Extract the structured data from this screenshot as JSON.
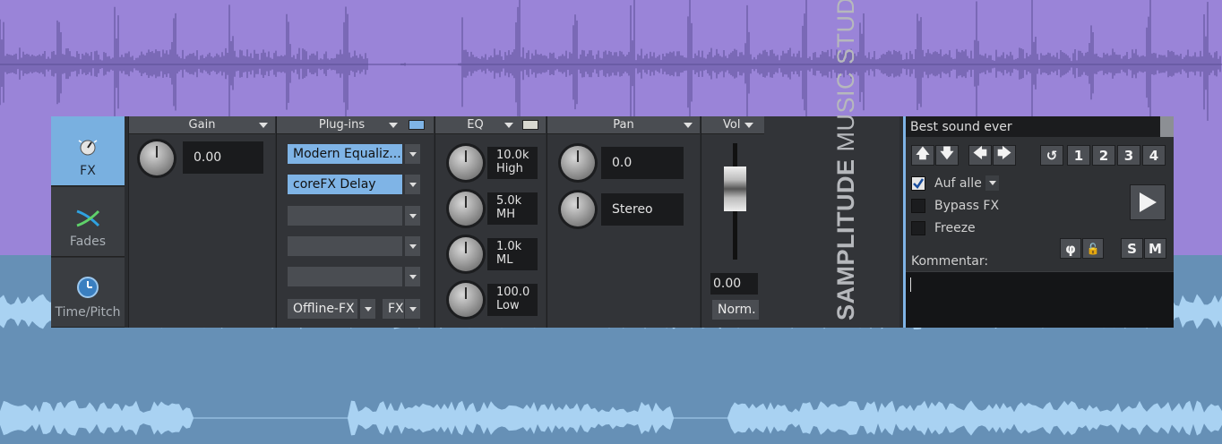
{
  "tabs": [
    {
      "label": "FX",
      "icon": "knob-icon",
      "active": true
    },
    {
      "label": "Fades",
      "icon": "fades-icon",
      "active": false
    },
    {
      "label": "Time/Pitch",
      "icon": "clock-icon",
      "active": false
    }
  ],
  "gain": {
    "header": "Gain",
    "value": "0.00"
  },
  "plugins": {
    "header": "Plug-ins",
    "slots": [
      "Modern Equaliz...",
      "coreFX Delay",
      "",
      "",
      ""
    ],
    "offline_label": "Offline-FX",
    "fx_label": "FX",
    "swatch_color": "#7fb4e6"
  },
  "eq": {
    "header": "EQ",
    "swatch_color": "#d8d8d0",
    "bands": [
      {
        "value": "10.0k",
        "name": "High"
      },
      {
        "value": "5.0k",
        "name": "MH"
      },
      {
        "value": "1.0k",
        "name": "ML"
      },
      {
        "value": "100.0",
        "name": "Low"
      }
    ]
  },
  "pan": {
    "header": "Pan",
    "value": "0.0",
    "mode": "Stereo"
  },
  "vol": {
    "header": "Vol",
    "value": "0.00",
    "norm_label": "Norm."
  },
  "brand": {
    "bold": "SAMPLITUDE",
    "light": " MUSIC STUDIO"
  },
  "right_panel": {
    "title": "Best sound ever",
    "numbers": [
      "1",
      "2",
      "3",
      "4"
    ],
    "auf_alle": {
      "label": "Auf alle",
      "checked": true
    },
    "bypass": {
      "label": "Bypass FX",
      "checked": false
    },
    "freeze": {
      "label": "Freeze",
      "checked": false
    },
    "kommentar_label": "Kommentar:",
    "phase_label": "φ",
    "solo_label": "S",
    "mute_label": "M"
  },
  "colors": {
    "accent": "#7fb4e6",
    "track_top": "#9a84d8",
    "track_bottom": "#6690b6"
  }
}
